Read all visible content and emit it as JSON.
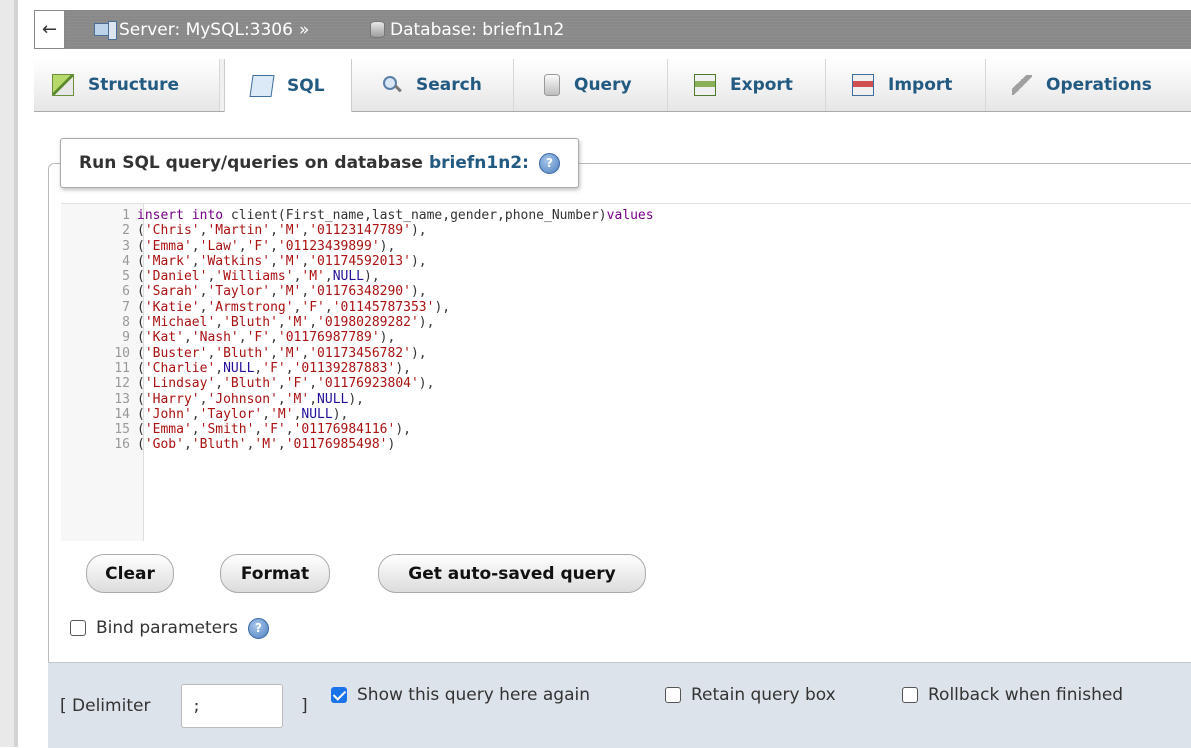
{
  "breadcrumb": {
    "back_arrow": "←",
    "server_label": "Server: MySQL:3306",
    "separator": "»",
    "database_label": "Database: briefn1n2"
  },
  "tabs": [
    {
      "label": "Structure",
      "icon": "structure-icon"
    },
    {
      "label": "SQL",
      "icon": "sql-icon",
      "active": true
    },
    {
      "label": "Search",
      "icon": "search-icon"
    },
    {
      "label": "Query",
      "icon": "query-icon"
    },
    {
      "label": "Export",
      "icon": "export-icon"
    },
    {
      "label": "Import",
      "icon": "import-icon"
    },
    {
      "label": "Operations",
      "icon": "operations-icon"
    }
  ],
  "query_box": {
    "legend_prefix": "Run SQL query/queries on database",
    "database_name": "briefn1n2:",
    "help_glyph": "?"
  },
  "editor": {
    "lines": [
      {
        "num": "1",
        "text": "insert into client(First_name,last_name,gender,phone_Number)values"
      },
      {
        "num": "2",
        "text": "('Chris','Martin','M','01123147789'),"
      },
      {
        "num": "3",
        "text": "('Emma','Law','F','01123439899'),"
      },
      {
        "num": "4",
        "text": "('Mark','Watkins','M','01174592013'),"
      },
      {
        "num": "5",
        "text": "('Daniel','Williams','M',NULL),"
      },
      {
        "num": "6",
        "text": "('Sarah','Taylor','M','01176348290'),"
      },
      {
        "num": "7",
        "text": "('Katie','Armstrong','F','01145787353'),"
      },
      {
        "num": "8",
        "text": "('Michael','Bluth','M','01980289282'),"
      },
      {
        "num": "9",
        "text": "('Kat','Nash','F','01176987789'),"
      },
      {
        "num": "10",
        "text": "('Buster','Bluth','M','01173456782'),"
      },
      {
        "num": "11",
        "text": "('Charlie',NULL,'F','01139287883'),"
      },
      {
        "num": "12",
        "text": "('Lindsay','Bluth','F','01176923804'),"
      },
      {
        "num": "13",
        "text": "('Harry','Johnson','M',NULL),"
      },
      {
        "num": "14",
        "text": "('John','Taylor','M',NULL),"
      },
      {
        "num": "15",
        "text": "('Emma','Smith','F','01176984116'),"
      },
      {
        "num": "16",
        "text": "('Gob','Bluth','M','01176985498')"
      }
    ]
  },
  "buttons": {
    "clear": "Clear",
    "format": "Format",
    "get_autosaved": "Get auto-saved query"
  },
  "bind_parameters": {
    "label": "Bind parameters",
    "checked": false
  },
  "options": {
    "delimiter_open": "[ Delimiter",
    "delimiter_value": ";",
    "delimiter_close": "]",
    "show_query_again": {
      "label": "Show this query here again",
      "checked": true
    },
    "retain_query_box": {
      "label": "Retain query box",
      "checked": false
    },
    "rollback_when_finished": {
      "label": "Rollback when finished",
      "checked": false
    }
  },
  "colors": {
    "link": "#235a81",
    "breadcrumb_bg": "#898989",
    "keyword": "#770088",
    "string": "#aa1111",
    "null": "#221199",
    "checkbox_checked": "#1a73e8",
    "panel_bg": "#dde3ea"
  }
}
